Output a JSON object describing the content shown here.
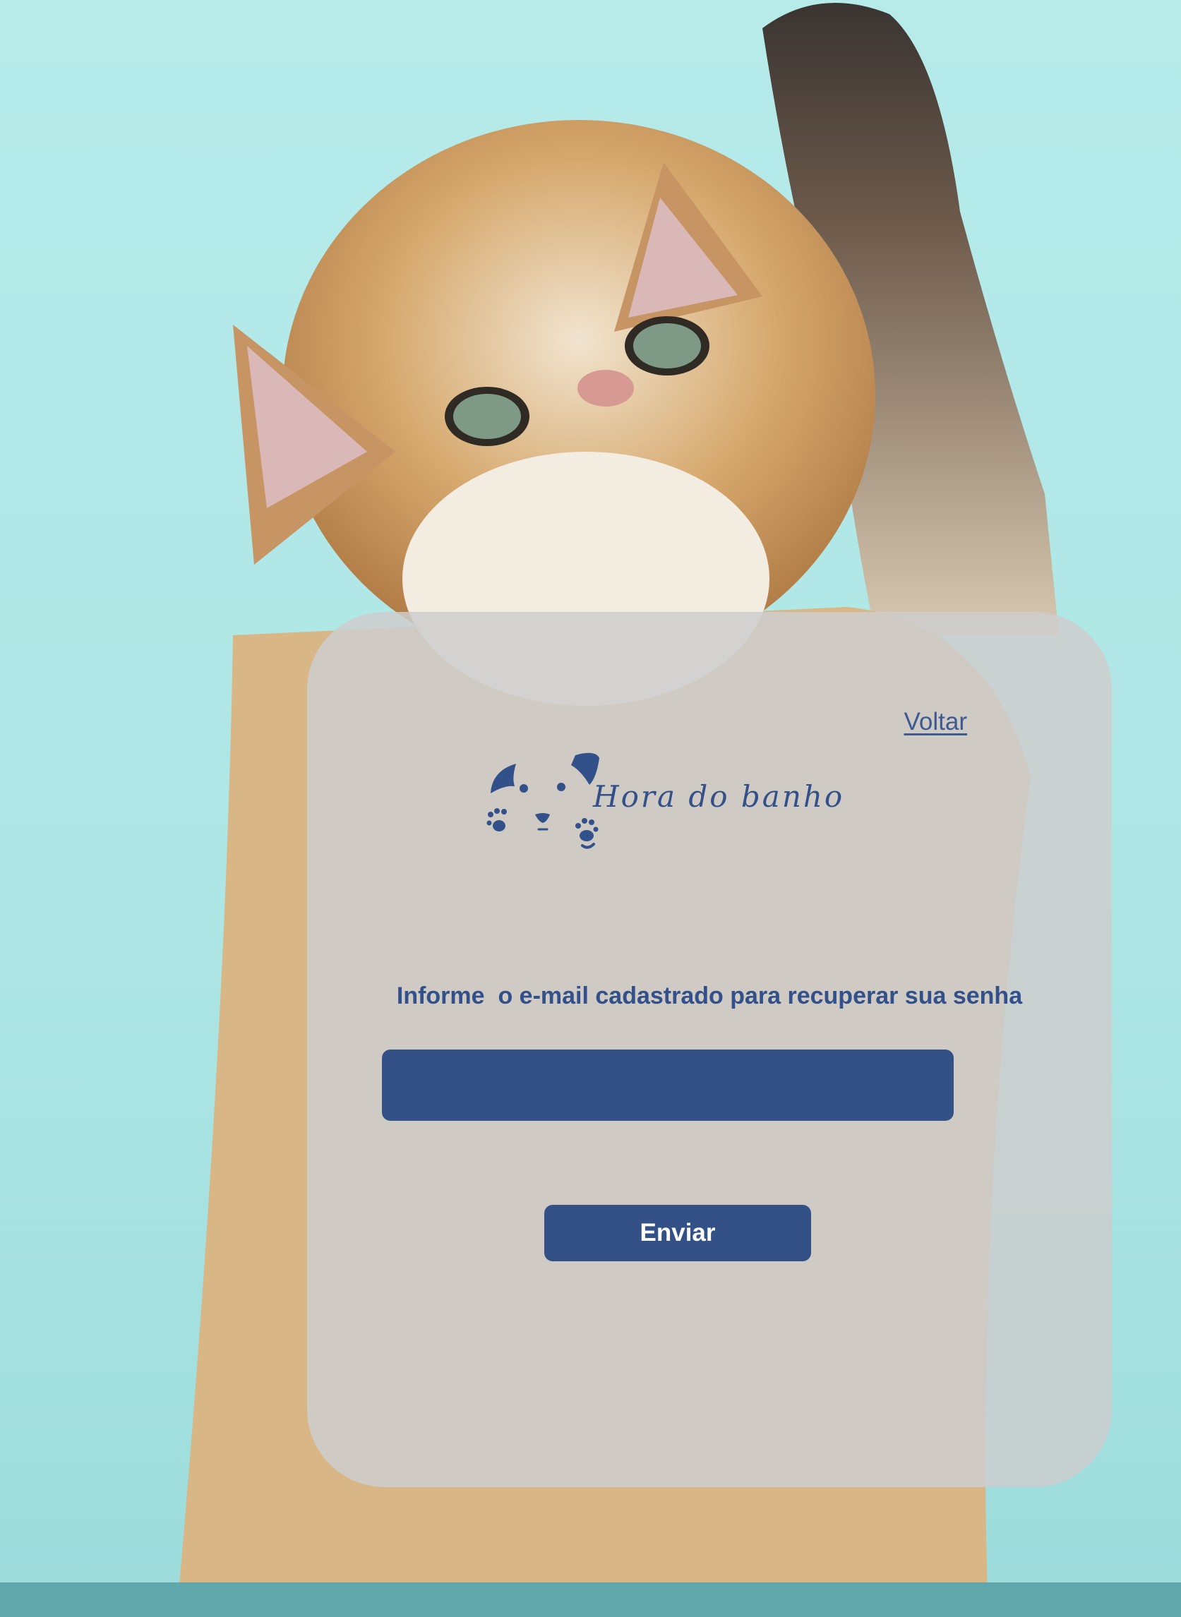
{
  "nav": {
    "back_label": "Voltar"
  },
  "brand": {
    "name": "Hora do banho",
    "logo_icon": "cat-dog-paws-icon"
  },
  "form": {
    "instruction": "Informe  o e-mail cadastrado para recuperar sua senha",
    "email_value": "",
    "email_placeholder": "",
    "submit_label": "Enviar"
  },
  "colors": {
    "accent": "#335187",
    "card": "#cdcdcd",
    "background": "#b6ebea"
  }
}
